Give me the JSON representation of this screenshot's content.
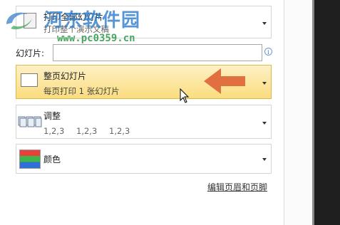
{
  "print_all": {
    "main": "打印全部幻灯片",
    "sub": "打印整个演示文稿"
  },
  "slides": {
    "label": "幻灯片:",
    "value": "",
    "info": "i"
  },
  "layout": {
    "main": "整页幻灯片",
    "sub": "每页打印 1 张幻灯片"
  },
  "collate": {
    "main": "调整",
    "order": [
      "1,2,3",
      "1,2,3",
      "1,2,3"
    ]
  },
  "color": {
    "main": "颜色"
  },
  "edit_header_footer": "编辑页眉和页脚",
  "watermark": {
    "title": "河东软件园",
    "url": "www.pc0359.cn"
  },
  "colors": {
    "highlight_top": "#fdf0c4",
    "highlight_bottom": "#fbdd7f",
    "arrow": "#e07040"
  }
}
